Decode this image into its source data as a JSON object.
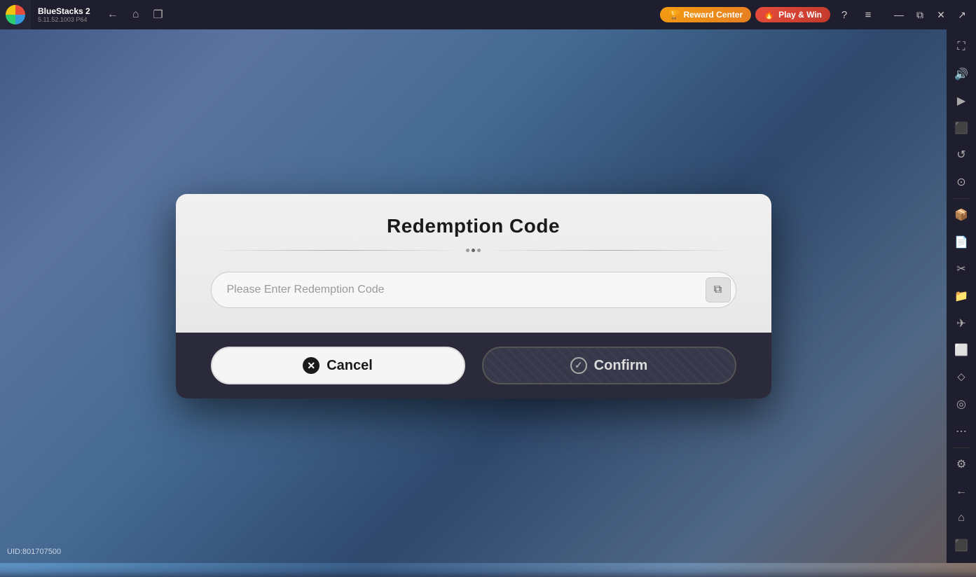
{
  "app": {
    "name": "BlueStacks 2",
    "version": "5.11.52.1003  P64"
  },
  "topbar": {
    "nav": {
      "back_label": "←",
      "home_label": "⌂",
      "layers_label": "❐"
    },
    "reward_center_label": "Reward Center",
    "play_win_label": "Play & Win",
    "icons": {
      "help": "?",
      "menu": "≡",
      "minimize": "—",
      "restore": "⧉",
      "close": "✕",
      "expand": "↗"
    }
  },
  "sidebar": {
    "icons": [
      "⛶",
      "🔊",
      "▶",
      "⬛",
      "↺",
      "⊙",
      "📦",
      "📄",
      "✂",
      "📁",
      "✈",
      "⬜",
      "⬦",
      "◎",
      "⋯",
      "⚙",
      "←",
      "⌂",
      "⬛"
    ]
  },
  "modal": {
    "title": "Redemption Code",
    "input_placeholder": "Please Enter Redemption Code",
    "cancel_label": "Cancel",
    "confirm_label": "Confirm",
    "copy_icon": "⧉"
  },
  "uid": {
    "label": "UID:801707500"
  }
}
